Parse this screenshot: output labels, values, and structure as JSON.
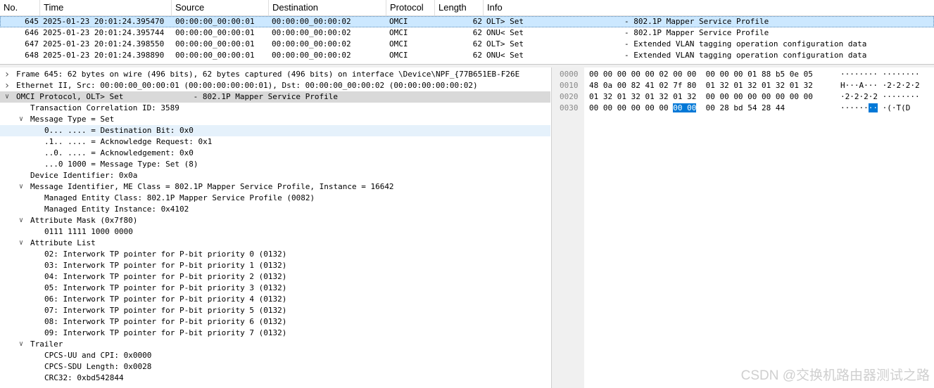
{
  "packet_list": {
    "columns": [
      "No.",
      "Time",
      "Source",
      "Destination",
      "Protocol",
      "Length",
      "Info"
    ],
    "rows": [
      {
        "no": "645",
        "time": "2025-01-23 20:01:24.395470",
        "src": "00:00:00_00:00:01",
        "dst": "00:00:00_00:00:02",
        "proto": "OMCI",
        "len": "62",
        "dir": "OLT> Set",
        "desc": "- 802.1P Mapper Service Profile",
        "selected": true
      },
      {
        "no": "646",
        "time": "2025-01-23 20:01:24.395744",
        "src": "00:00:00_00:00:01",
        "dst": "00:00:00_00:00:02",
        "proto": "OMCI",
        "len": "62",
        "dir": "ONU< Set",
        "desc": "- 802.1P Mapper Service Profile",
        "selected": false
      },
      {
        "no": "647",
        "time": "2025-01-23 20:01:24.398550",
        "src": "00:00:00_00:00:01",
        "dst": "00:00:00_00:00:02",
        "proto": "OMCI",
        "len": "62",
        "dir": "OLT> Set",
        "desc": "- Extended VLAN tagging operation configuration data",
        "selected": false
      },
      {
        "no": "648",
        "time": "2025-01-23 20:01:24.398890",
        "src": "00:00:00_00:00:01",
        "dst": "00:00:00_00:00:02",
        "proto": "OMCI",
        "len": "62",
        "dir": "ONU< Set",
        "desc": "- Extended VLAN tagging operation configuration data",
        "selected": false
      }
    ]
  },
  "details": [
    {
      "indent": 0,
      "arrow": "collapsed",
      "text": "Frame 645: 62 bytes on wire (496 bits), 62 bytes captured (496 bits) on interface \\Device\\NPF_{77B651EB-F26E"
    },
    {
      "indent": 0,
      "arrow": "collapsed",
      "text": "Ethernet II, Src: 00:00:00_00:00:01 (00:00:00:00:00:01), Dst: 00:00:00_00:00:02 (00:00:00:00:00:02)"
    },
    {
      "indent": 0,
      "arrow": "expanded",
      "text": "OMCI Protocol, OLT> Set               - 802.1P Mapper Service Profile",
      "state": "selected"
    },
    {
      "indent": 1,
      "arrow": "none",
      "text": "Transaction Correlation ID: 3589"
    },
    {
      "indent": 1,
      "arrow": "expanded",
      "text": "Message Type = Set"
    },
    {
      "indent": 2,
      "arrow": "none",
      "text": "0... .... = Destination Bit: 0x0",
      "state": "hover"
    },
    {
      "indent": 2,
      "arrow": "none",
      "text": ".1.. .... = Acknowledge Request: 0x1"
    },
    {
      "indent": 2,
      "arrow": "none",
      "text": "..0. .... = Acknowledgement: 0x0"
    },
    {
      "indent": 2,
      "arrow": "none",
      "text": "...0 1000 = Message Type: Set (8)"
    },
    {
      "indent": 1,
      "arrow": "none",
      "text": "Device Identifier: 0x0a"
    },
    {
      "indent": 1,
      "arrow": "expanded",
      "text": "Message Identifier, ME Class = 802.1P Mapper Service Profile, Instance = 16642"
    },
    {
      "indent": 2,
      "arrow": "none",
      "text": "Managed Entity Class: 802.1P Mapper Service Profile (0082)"
    },
    {
      "indent": 2,
      "arrow": "none",
      "text": "Managed Entity Instance: 0x4102"
    },
    {
      "indent": 1,
      "arrow": "expanded",
      "text": "Attribute Mask (0x7f80)"
    },
    {
      "indent": 2,
      "arrow": "none",
      "text": "0111 1111 1000 0000"
    },
    {
      "indent": 1,
      "arrow": "expanded",
      "text": "Attribute List"
    },
    {
      "indent": 2,
      "arrow": "none",
      "text": "02: Interwork TP pointer for P-bit priority 0 (0132)"
    },
    {
      "indent": 2,
      "arrow": "none",
      "text": "03: Interwork TP pointer for P-bit priority 1 (0132)"
    },
    {
      "indent": 2,
      "arrow": "none",
      "text": "04: Interwork TP pointer for P-bit priority 2 (0132)"
    },
    {
      "indent": 2,
      "arrow": "none",
      "text": "05: Interwork TP pointer for P-bit priority 3 (0132)"
    },
    {
      "indent": 2,
      "arrow": "none",
      "text": "06: Interwork TP pointer for P-bit priority 4 (0132)"
    },
    {
      "indent": 2,
      "arrow": "none",
      "text": "07: Interwork TP pointer for P-bit priority 5 (0132)"
    },
    {
      "indent": 2,
      "arrow": "none",
      "text": "08: Interwork TP pointer for P-bit priority 6 (0132)"
    },
    {
      "indent": 2,
      "arrow": "none",
      "text": "09: Interwork TP pointer for P-bit priority 7 (0132)"
    },
    {
      "indent": 1,
      "arrow": "expanded",
      "text": "Trailer"
    },
    {
      "indent": 2,
      "arrow": "none",
      "text": "CPCS-UU and CPI: 0x0000"
    },
    {
      "indent": 2,
      "arrow": "none",
      "text": "CPCS-SDU Length: 0x0028"
    },
    {
      "indent": 2,
      "arrow": "none",
      "text": "CRC32: 0xbd542844"
    }
  ],
  "bytes": [
    {
      "offset": "0000",
      "hex_a": "00 00 00 00 00 02 00 00",
      "hex_b": "00 00 00 01 88 b5 0e 05",
      "ascii": "········ ········"
    },
    {
      "offset": "0010",
      "hex_a": "48 0a 00 82 41 02 7f 80",
      "hex_b": "01 32 01 32 01 32 01 32",
      "ascii": "H···A··· ·2·2·2·2"
    },
    {
      "offset": "0020",
      "hex_a": "01 32 01 32 01 32 01 32",
      "hex_b": "00 00 00 00 00 00 00 00",
      "ascii": "·2·2·2·2 ········"
    },
    {
      "offset": "0030",
      "hex_pre": "00 00 00 00 00 00 ",
      "hex_sel": "00 00",
      "hex_post": "  00 28 bd 54 28 44",
      "ascii_pre": "······",
      "ascii_sel": "··",
      "ascii_post": " ·(·T(D"
    }
  ],
  "watermark": "CSDN @交换机路由器测试之路",
  "colors": {
    "selected_row": "#cce8ff",
    "hover_row": "#e5f1fb",
    "selected_tree": "#d9d9d9",
    "hex_selection": "#0078d7"
  }
}
